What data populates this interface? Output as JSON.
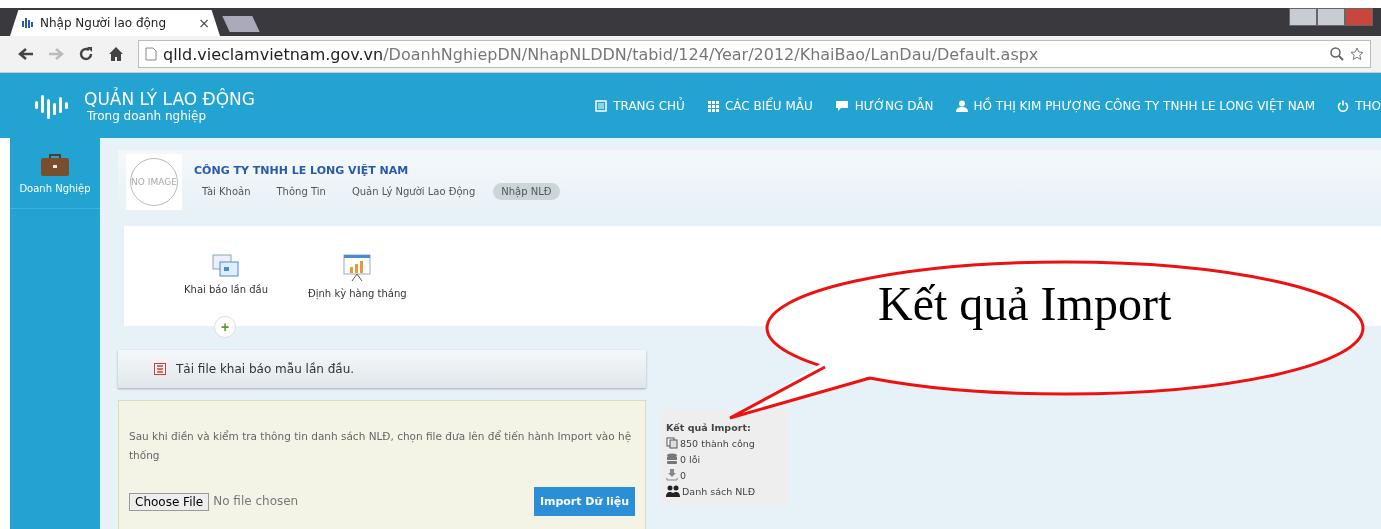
{
  "browser": {
    "tab_title": "Nhập Người lao động",
    "tab_close": "×",
    "url_host": "qlld.vieclamvietnam.gov.vn",
    "url_path": "/DoanhNghiepDN/NhapNLDDN/tabid/124/Year/2012/KhaiBao/LanDau/Default.aspx"
  },
  "header": {
    "title": "QUẢN LÝ LAO ĐỘNG",
    "subtitle": "Trong doanh nghiệp",
    "nav": [
      {
        "label": "TRANG CHỦ",
        "kind": "home"
      },
      {
        "label": "CÁC BIỂU MẪU",
        "kind": "grid"
      },
      {
        "label": "HƯỚNG DẪN",
        "kind": "chat"
      },
      {
        "label": "HỒ THỊ KIM PHƯỢNG CÔNG TY TNHH LE LONG VIỆT NAM",
        "kind": "user"
      },
      {
        "label": "THO",
        "kind": "power"
      }
    ]
  },
  "sidebar": {
    "items": [
      {
        "label": "Doanh Nghiệp"
      }
    ]
  },
  "company": {
    "logo_text": "NO IMAGE",
    "name": "CÔNG TY TNHH LE LONG VIỆT NAM",
    "tabs": [
      {
        "label": "Tài Khoản",
        "selected": false
      },
      {
        "label": "Thông Tin",
        "selected": false
      },
      {
        "label": "Quản Lý Người Lao Động",
        "selected": false
      },
      {
        "label": "Nhập NLĐ",
        "selected": true
      }
    ]
  },
  "steps": [
    {
      "label": "Khai báo lần đầu",
      "kind": "form"
    },
    {
      "label": "Định kỳ hàng tháng",
      "kind": "chart"
    }
  ],
  "step_add": "+",
  "download_bar": {
    "label": "Tải file khai báo mẫu lần đầu."
  },
  "upload": {
    "instructions": "Sau khi điền và kiểm tra thông tin danh sách NLĐ, chọn file đưa lên để tiến hành Import vào hệ thống",
    "choose_button": "Choose File",
    "file_status": "No file chosen",
    "import_button": "Import Dữ liệu"
  },
  "result": {
    "title": "Kết quả Import:",
    "lines": [
      {
        "label": "850 thành công",
        "kind": "copy"
      },
      {
        "label": "0 lỗi",
        "kind": "db"
      },
      {
        "label": "0",
        "kind": "download"
      },
      {
        "label": "Danh sách NLĐ",
        "kind": "people"
      }
    ]
  },
  "callout": {
    "text": "Kết quả Import"
  }
}
